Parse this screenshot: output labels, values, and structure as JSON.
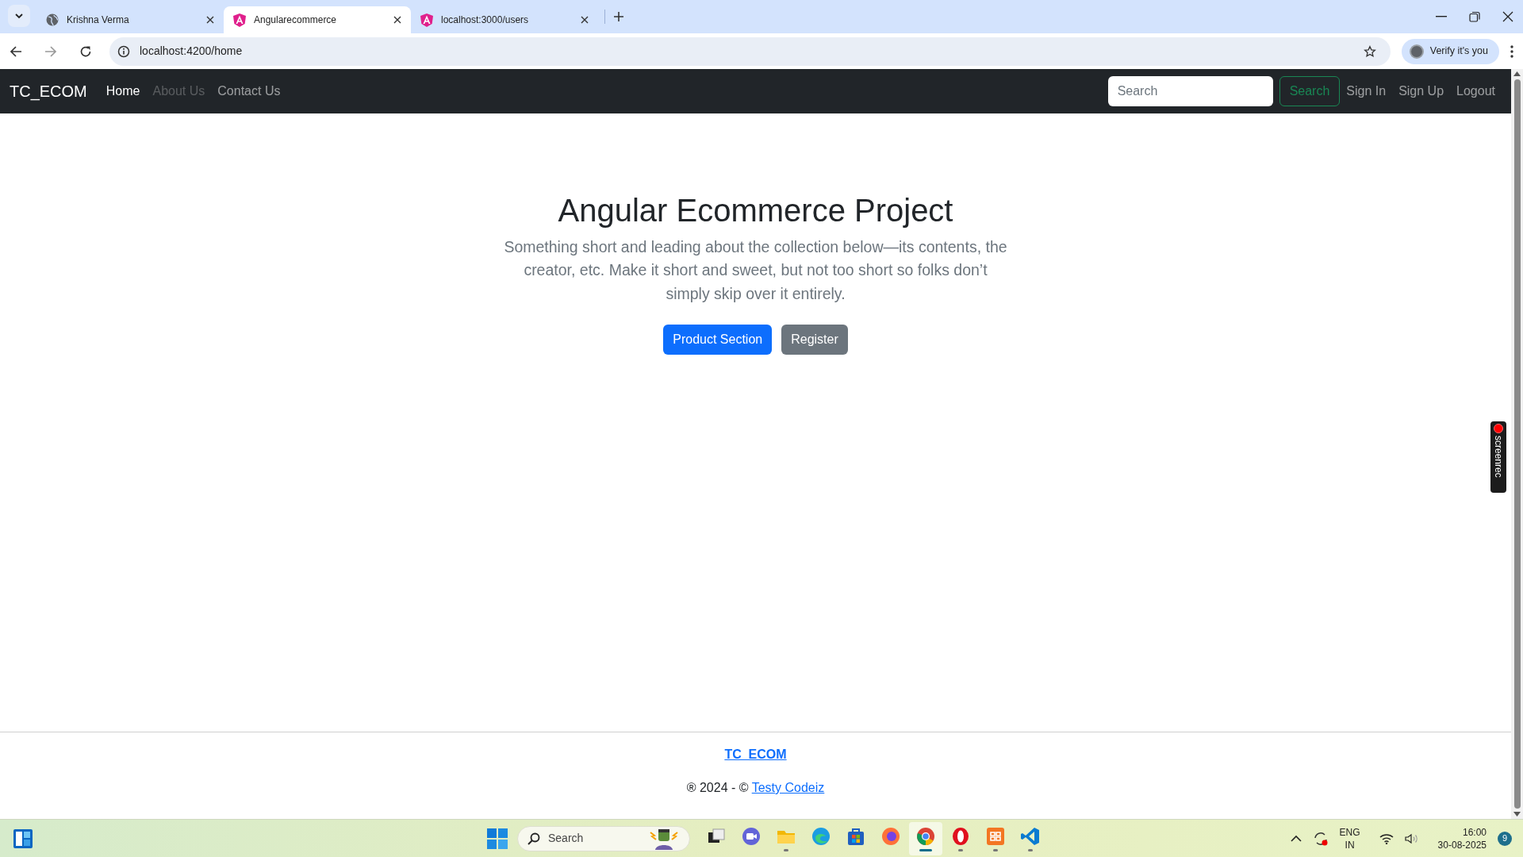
{
  "browser": {
    "tabs": [
      {
        "title": "Krishna Verma",
        "kind": "globe",
        "selected": false
      },
      {
        "title": "Angularecommerce",
        "kind": "angular",
        "selected": true
      },
      {
        "title": "localhost:3000/users",
        "kind": "angular",
        "selected": false
      }
    ],
    "address": "localhost:4200/home",
    "profile_button": "Verify it's you"
  },
  "navbar": {
    "brand": "TC_ECOM",
    "links": [
      {
        "label": "Home",
        "selected": true,
        "disabled": false
      },
      {
        "label": "About Us",
        "selected": false,
        "disabled": true
      },
      {
        "label": "Contact Us",
        "selected": false,
        "disabled": false
      }
    ],
    "search": {
      "placeholder": "Search"
    },
    "search_button": "Search",
    "auth_links": [
      "Sign In",
      "Sign Up",
      "Logout"
    ]
  },
  "hero": {
    "title": "Angular Ecommerce Project",
    "lead": "Something short and leading about the collection below—its contents, the creator, etc. Make it short and sweet, but not too short so folks don’t simply skip over it entirely.",
    "buttons": [
      {
        "label": "Product Section",
        "kind": "primary"
      },
      {
        "label": "Register",
        "kind": "secondary"
      }
    ]
  },
  "footer": {
    "brand_link": "TC_ECOM",
    "copyright": "® 2024 - © ",
    "author_link": "Testy Codeiz"
  },
  "recorder": {
    "label": "screenrec"
  },
  "taskbar": {
    "search": {
      "placeholder": "Search"
    },
    "apps": [
      {
        "kind": "taskview",
        "running": false,
        "selected": false
      },
      {
        "kind": "chat",
        "running": false,
        "selected": false
      },
      {
        "kind": "folder",
        "running": true,
        "selected": false
      },
      {
        "kind": "edge",
        "running": false,
        "selected": false
      },
      {
        "kind": "store",
        "running": false,
        "selected": false
      },
      {
        "kind": "firefox",
        "running": false,
        "selected": false
      },
      {
        "kind": "chrome",
        "running": true,
        "selected": true
      },
      {
        "kind": "opera",
        "running": true,
        "selected": false
      },
      {
        "kind": "xampp",
        "running": true,
        "selected": false
      },
      {
        "kind": "vscode",
        "running": true,
        "selected": false
      }
    ],
    "language": [
      "ENG",
      "IN"
    ],
    "time": "16:00",
    "date": "30-08-2025",
    "notifications": "9"
  }
}
